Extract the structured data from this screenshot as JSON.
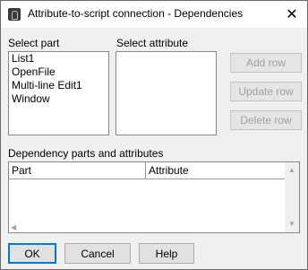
{
  "dialog": {
    "title": "Attribute-to-script connection - Dependencies",
    "close_glyph": "✕"
  },
  "select_part": {
    "label": "Select part",
    "items": [
      "List1",
      "OpenFile",
      "Multi-line Edit1",
      "Window"
    ]
  },
  "select_attribute": {
    "label": "Select attribute",
    "items": []
  },
  "actions": {
    "add_row": "Add row",
    "update_row": "Update row",
    "delete_row": "Delete row"
  },
  "dependencies": {
    "label": "Dependency parts and attributes",
    "columns": [
      "Part",
      "Attribute"
    ],
    "rows": []
  },
  "footer": {
    "ok": "OK",
    "cancel": "Cancel",
    "help": "Help"
  },
  "icons": {
    "scroll_up": "▲",
    "scroll_down": "▼",
    "scroll_left": "◀"
  }
}
